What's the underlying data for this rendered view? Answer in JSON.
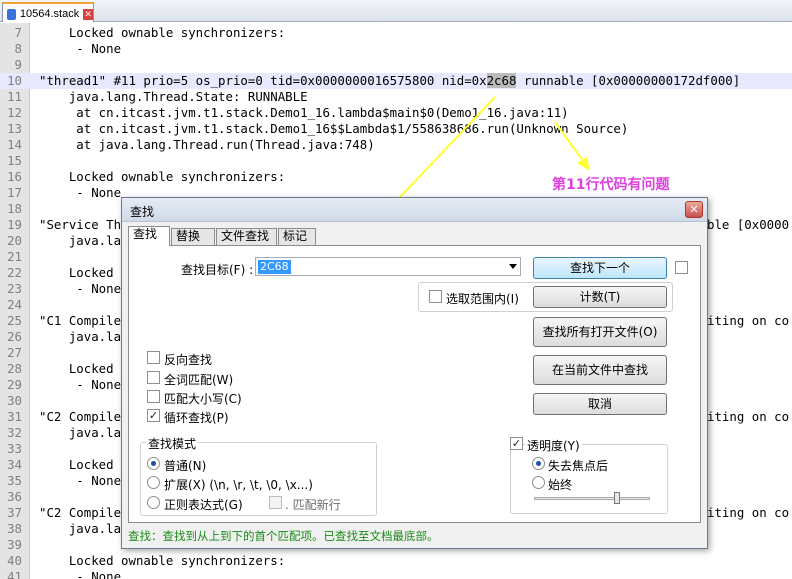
{
  "tab": {
    "filename": "10564.stack"
  },
  "editor": {
    "lines": [
      {
        "num": "7",
        "text": "    Locked ownable synchronizers:"
      },
      {
        "num": "8",
        "text": "     - None"
      },
      {
        "num": "9",
        "text": ""
      },
      {
        "num": "10",
        "text": "\"thread1\" #11 prio=5 os_prio=0 tid=0x0000000016575800 nid=0x",
        "match": "2c68",
        "rest": " runnable [0x00000000172df000]"
      },
      {
        "num": "11",
        "text": "    java.lang.Thread.State: RUNNABLE"
      },
      {
        "num": "12",
        "text": "     at cn.itcast.jvm.t1.stack.Demo1_16.lambda$main$0(Demo1_16.java:11)"
      },
      {
        "num": "13",
        "text": "     at cn.itcast.jvm.t1.stack.Demo1_16$$Lambda$1/558638686.run(Unknown Source)"
      },
      {
        "num": "14",
        "text": "     at java.lang.Thread.run(Thread.java:748)"
      },
      {
        "num": "15",
        "text": ""
      },
      {
        "num": "16",
        "text": "    Locked ownable synchronizers:"
      },
      {
        "num": "17",
        "text": "     - None"
      },
      {
        "num": "18",
        "text": ""
      },
      {
        "num": "19",
        "text": "\"Service Th",
        "tail": "ble [0x0000"
      },
      {
        "num": "20",
        "text": "    java.lan"
      },
      {
        "num": "21",
        "text": ""
      },
      {
        "num": "22",
        "text": "    Locked o"
      },
      {
        "num": "23",
        "text": "     - None"
      },
      {
        "num": "24",
        "text": ""
      },
      {
        "num": "25",
        "text": "\"C1 Compile",
        "tail": "iting on co"
      },
      {
        "num": "26",
        "text": "    java.lan"
      },
      {
        "num": "27",
        "text": ""
      },
      {
        "num": "28",
        "text": "    Locked o"
      },
      {
        "num": "29",
        "text": "     - None"
      },
      {
        "num": "30",
        "text": ""
      },
      {
        "num": "31",
        "text": "\"C2 Compile",
        "tail": "iting on co"
      },
      {
        "num": "32",
        "text": "    java.lan"
      },
      {
        "num": "33",
        "text": ""
      },
      {
        "num": "34",
        "text": "    Locked o"
      },
      {
        "num": "35",
        "text": "     - None"
      },
      {
        "num": "36",
        "text": ""
      },
      {
        "num": "37",
        "text": "\"C2 Compile",
        "tail": "iting on co"
      },
      {
        "num": "38",
        "text": "    java.lan"
      },
      {
        "num": "39",
        "text": ""
      },
      {
        "num": "40",
        "text": "    Locked ownable synchronizers:"
      },
      {
        "num": "41",
        "text": "     - None"
      }
    ]
  },
  "annotation": {
    "text": "第11行代码有问题",
    "color": "#e040e0",
    "arrow_color": "#ffff33"
  },
  "dialog": {
    "title": "查找",
    "tabs": [
      "查找",
      "替换",
      "文件查找",
      "标记"
    ],
    "find_label": "查找目标(F) :",
    "find_value": "2C68",
    "btn_find_next": "查找下一个",
    "in_selection": "选取范围内(I)",
    "btn_count": "计数(T)",
    "btn_find_all_open": "查找所有打开文件(O)",
    "btn_find_all_current": "在当前文件中查找",
    "btn_cancel": "取消",
    "opt_backward": "反向查找",
    "opt_whole_word": "全词匹配(W)",
    "opt_match_case": "匹配大小写(C)",
    "opt_wrap": "循环查找(P)",
    "search_mode_title": "查找模式",
    "mode_normal": "普通(N)",
    "mode_extended": "扩展(X) (\\n, \\r, \\t, \\0, \\x...)",
    "mode_regex": "正则表达式(G)",
    "dot_newline": ". 匹配新行",
    "transparency_label": "透明度(Y)",
    "trans_on_lose_focus": "失去焦点后",
    "trans_always": "始终",
    "status": "查找：查找到从上到下的首个匹配项。已查找至文档最底部。"
  }
}
